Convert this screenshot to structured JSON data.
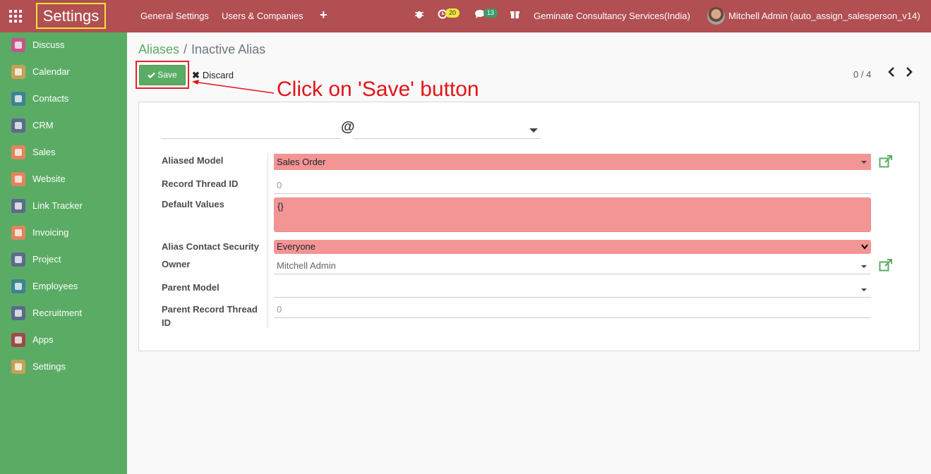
{
  "topbar": {
    "app_title": "Settings",
    "menu": [
      "General Settings",
      "Users & Companies"
    ],
    "activity_count": "20",
    "message_count": "13",
    "company": "Geminate Consultancy Services(India)",
    "user": "Mitchell Admin (auto_assign_salesperson_v14)"
  },
  "sidebar": {
    "items": [
      {
        "label": "Discuss",
        "color": "#c0578a"
      },
      {
        "label": "Calendar",
        "color": "#c5a257"
      },
      {
        "label": "Contacts",
        "color": "#3e8294"
      },
      {
        "label": "CRM",
        "color": "#5c6a8c"
      },
      {
        "label": "Sales",
        "color": "#e2855c"
      },
      {
        "label": "Website",
        "color": "#e2855c"
      },
      {
        "label": "Link Tracker",
        "color": "#5c6a8c"
      },
      {
        "label": "Invoicing",
        "color": "#e2855c"
      },
      {
        "label": "Project",
        "color": "#5c6a8c"
      },
      {
        "label": "Employees",
        "color": "#3e8294"
      },
      {
        "label": "Recruitment",
        "color": "#5c6a8c"
      },
      {
        "label": "Apps",
        "color": "#9b4b4b"
      },
      {
        "label": "Settings",
        "color": "#c5a257"
      }
    ]
  },
  "breadcrumb": {
    "parent": "Aliases",
    "separator": "/",
    "current": "Inactive Alias"
  },
  "actions": {
    "save": "Save",
    "discard": "Discard"
  },
  "pager": {
    "value": "0 / 4"
  },
  "annotation": {
    "text": "Click on 'Save' button",
    "color": "#e0151b"
  },
  "form": {
    "at": "@",
    "fields": [
      {
        "label": "Aliased Model",
        "value": "Sales Order"
      },
      {
        "label": "Record Thread ID",
        "value": "0"
      },
      {
        "label": "Default Values",
        "value": "{}"
      },
      {
        "label": "Alias Contact Security",
        "value": "Everyone"
      },
      {
        "label": "Owner",
        "value": "Mitchell Admin"
      },
      {
        "label": "Parent Model",
        "value": ""
      },
      {
        "label": "Parent Record Thread ID",
        "value": "0"
      }
    ]
  },
  "colors": {
    "topbar": "#b24f52",
    "sidebar": "#5aac64",
    "required": "#f39595",
    "accent": "#5aac64"
  }
}
